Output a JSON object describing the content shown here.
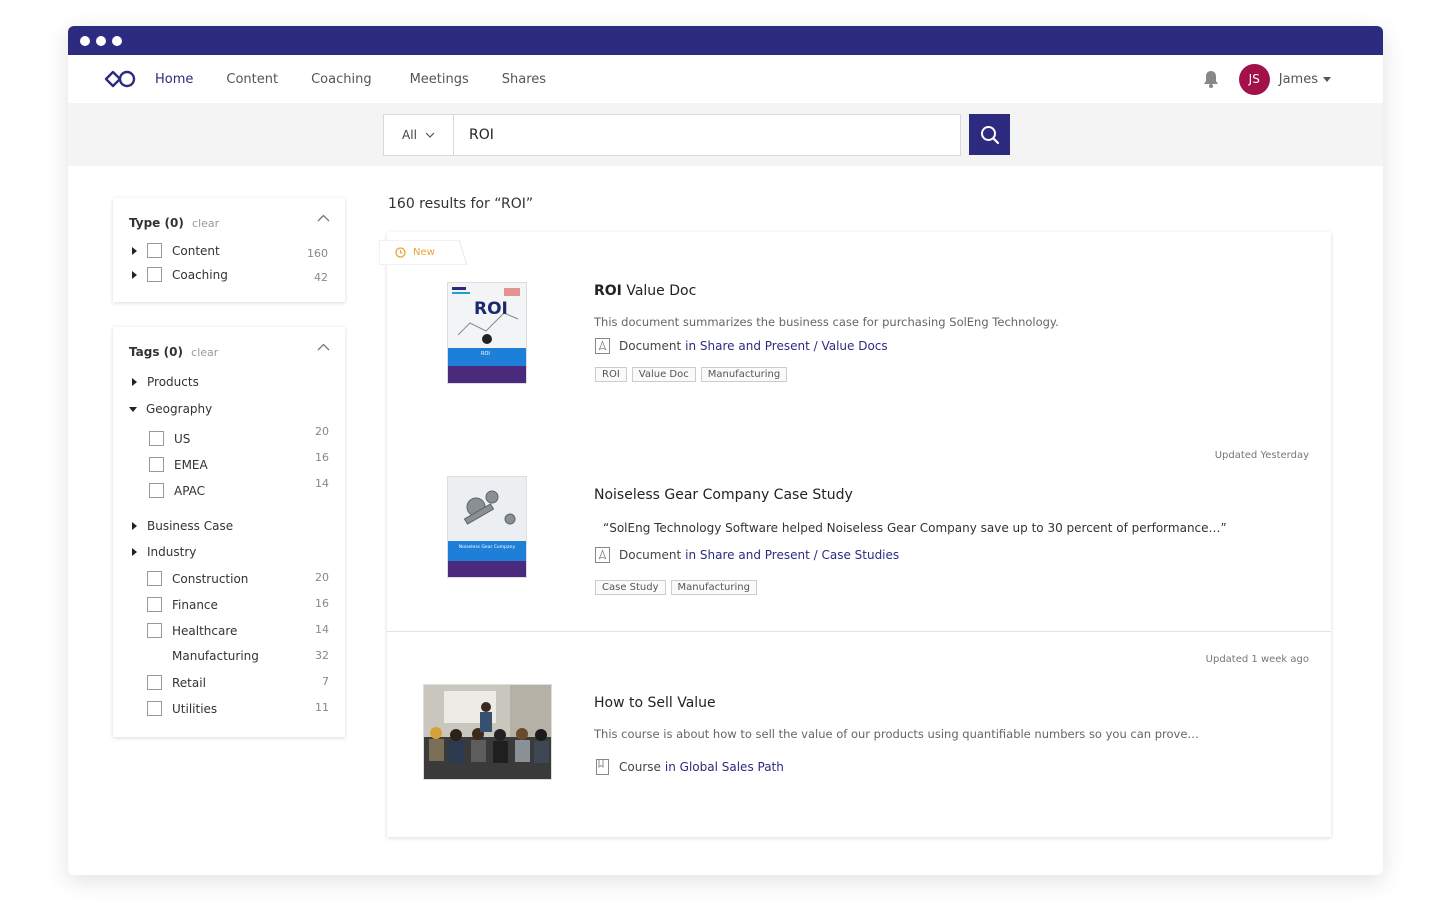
{
  "nav": {
    "items": [
      "Home",
      "Content",
      "Coaching",
      "Meetings",
      "Shares"
    ],
    "user_initials": "JS",
    "user_name": "James"
  },
  "search": {
    "scope": "All",
    "query": "ROI"
  },
  "filters": {
    "type": {
      "title": "Type",
      "count": "(0)",
      "clear": "clear",
      "items": [
        {
          "label": "Content",
          "count": "160"
        },
        {
          "label": "Coaching",
          "count": "42"
        }
      ]
    },
    "tags": {
      "title": "Tags",
      "count": "(0)",
      "clear": "clear",
      "products": "Products",
      "geography": "Geography",
      "geo_items": [
        {
          "label": "US",
          "count": "20"
        },
        {
          "label": "EMEA",
          "count": "16"
        },
        {
          "label": "APAC",
          "count": "14"
        }
      ],
      "business_case": "Business Case",
      "industry": "Industry",
      "industry_items": [
        {
          "label": "Construction",
          "count": "20"
        },
        {
          "label": "Finance",
          "count": "16"
        },
        {
          "label": "Healthcare",
          "count": "14"
        },
        {
          "label": "Manufacturing",
          "count": "32"
        },
        {
          "label": "Retail",
          "count": "7"
        },
        {
          "label": "Utilities",
          "count": "11"
        }
      ]
    }
  },
  "results": {
    "summary": "160 results for “ROI”",
    "new_label": "New",
    "items": [
      {
        "title_bold": "ROI",
        "title_rest": " Value Doc",
        "description": "This document summarizes the business case for purchasing SolEng Technology.",
        "type": "Document",
        "location": "in Share and Present / Value Docs",
        "tags": [
          "ROI",
          "Value Doc",
          "Manufacturing"
        ],
        "thumb_text": "ROI",
        "thumb_small": "ROI"
      },
      {
        "updated": "Updated Yesterday",
        "title": "Noiseless Gear Company Case Study",
        "quote": "“SolEng Technology Software helped Noiseless Gear Company save up to 30 percent of performance…”",
        "type": "Document",
        "location": "in Share and Present / Case Studies",
        "tags": [
          "Case Study",
          "Manufacturing"
        ],
        "thumb_text": "Noiseless Gear Company"
      },
      {
        "updated": "Updated 1 week ago",
        "title": "How to Sell Value",
        "description": "This course is about how to sell the value of our products using quantifiable numbers so you can prove…",
        "type": "Course",
        "location": "in Global Sales Path"
      }
    ]
  },
  "colors": {
    "brand": "#2d2b7f",
    "avatar": "#a3114b",
    "new_badge": "#e5a23b"
  }
}
